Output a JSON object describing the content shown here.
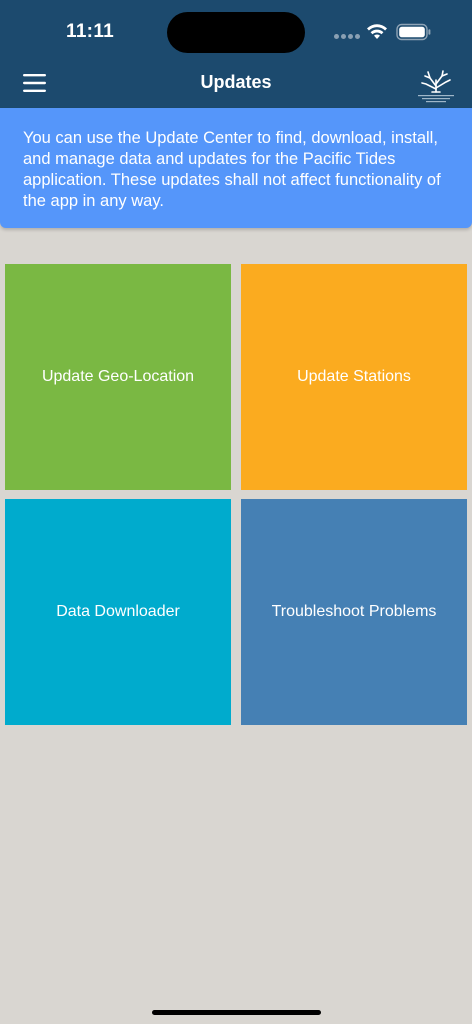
{
  "status_bar": {
    "time": "11:11"
  },
  "header": {
    "title": "Updates",
    "background_color": "#1c4a6e",
    "menu_icon": "hamburger-menu-icon",
    "logo_icon": "coral-logo-icon"
  },
  "info_banner": {
    "text": "You can use the Update Center to find, download, install, and manage data and updates for the Pacific Tides application. These updates shall not affect functionality of the app in any way.",
    "color": "#5596fa"
  },
  "tiles": [
    {
      "label": "Update Geo-Location",
      "color": "#7ab843"
    },
    {
      "label": "Update Stations",
      "color": "#fbab1f"
    },
    {
      "label": "Data Downloader",
      "color": "#00abcd"
    },
    {
      "label": "Troubleshoot Problems",
      "color": "#4580b4"
    }
  ]
}
